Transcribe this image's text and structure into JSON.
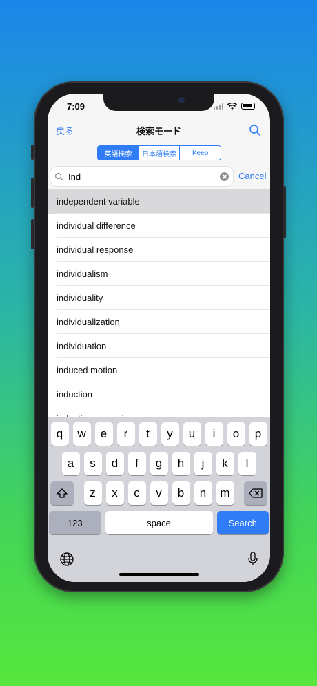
{
  "status": {
    "time": "7:09"
  },
  "nav": {
    "back_label": "戻る",
    "title": "検索モード",
    "search_icon": "search-icon"
  },
  "segments": [
    {
      "label": "英語検索",
      "active": true
    },
    {
      "label": "日本語検索",
      "active": false
    },
    {
      "label": "Keep",
      "active": false
    }
  ],
  "search": {
    "value": "Ind",
    "placeholder": "",
    "cancel_label": "Cancel"
  },
  "results": [
    {
      "text": "independent variable",
      "selected": true
    },
    {
      "text": "individual difference"
    },
    {
      "text": "individual response"
    },
    {
      "text": "individualism"
    },
    {
      "text": "individuality"
    },
    {
      "text": "individualization"
    },
    {
      "text": "individuation"
    },
    {
      "text": "induced motion"
    },
    {
      "text": "induction"
    },
    {
      "text": "inductive reasoning"
    }
  ],
  "keyboard": {
    "row1": [
      "q",
      "w",
      "e",
      "r",
      "t",
      "y",
      "u",
      "i",
      "o",
      "p"
    ],
    "row2": [
      "a",
      "s",
      "d",
      "f",
      "g",
      "h",
      "j",
      "k",
      "l"
    ],
    "row3": [
      "z",
      "x",
      "c",
      "v",
      "b",
      "n",
      "m"
    ],
    "numbers_label": "123",
    "space_label": "space",
    "action_label": "Search"
  },
  "colors": {
    "accent": "#2f7cf6",
    "bg_top": "#1b86ea",
    "bg_bottom": "#56e63c"
  }
}
